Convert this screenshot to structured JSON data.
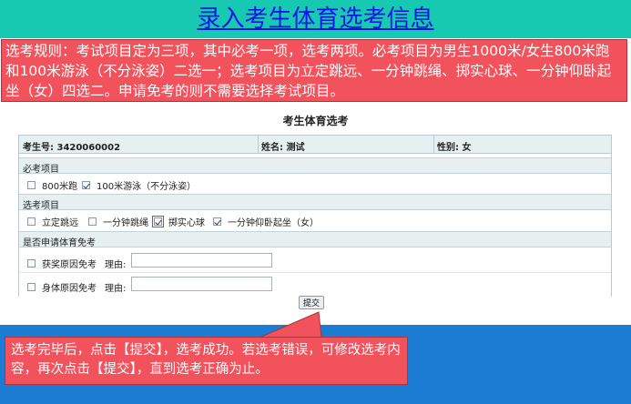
{
  "page": {
    "title": "录入考生体育选考信息",
    "rules_note": "选考规则：考试项目定为三项，其中必考一项，选考两项。必考项目为男生1000米/女生800米跑和100米游泳（不分泳姿）二选一；选考项目为立定跳远、一分钟跳绳、掷实心球、一分钟仰卧起坐（女）四选二。申请免考的则不需要选择考试项目。",
    "submit_note": "选考完毕后，点击【提交】，选考成功。若选考错误，可修改选考内容，再次点击【提交】，直到选考正确为止。"
  },
  "form": {
    "title": "考生体育选考",
    "student": {
      "id_label": "考生号: 3420060002",
      "name_label": "姓名: 测试",
      "gender_label": "性别: 女"
    },
    "required_section": {
      "label": "必考项目",
      "options": [
        {
          "label": "800米跑",
          "checked": false
        },
        {
          "label": "100米游泳（不分泳姿）",
          "checked": true
        }
      ]
    },
    "elective_section": {
      "label": "选考项目",
      "options": [
        {
          "label": "立定跳远",
          "checked": false
        },
        {
          "label": "一分钟跳绳",
          "checked": false
        },
        {
          "label": "掷实心球",
          "checked": true
        },
        {
          "label": "一分钟仰卧起坐（女）",
          "checked": true
        }
      ]
    },
    "exemption_section": {
      "label": "是否申请体育免考",
      "options": [
        {
          "label": "获奖原因免考",
          "reason_label": "理由:",
          "reason_value": "",
          "checked": false
        },
        {
          "label": "身体原因免考",
          "reason_label": "理由:",
          "reason_value": "",
          "checked": false
        }
      ]
    },
    "submit_label": "提交"
  },
  "colors": {
    "title_bar": "#17c9b1",
    "title_text": "#1515e8",
    "callout": "#f1525c",
    "bottom_band": "#1c7bd3",
    "section_bg": "#e6f0f1"
  }
}
